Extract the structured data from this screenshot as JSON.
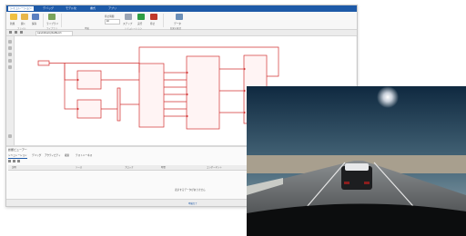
{
  "ribbon": {
    "tabs": [
      "シミュレーション",
      "デバッグ",
      "モデル化",
      "書式",
      "アプリ"
    ],
    "buttons": [
      {
        "label": "新規",
        "icon": "new-icon"
      },
      {
        "label": "開く",
        "icon": "open-folder-icon"
      },
      {
        "label": "保存",
        "icon": "save-icon"
      },
      {
        "label": "ライブラリ",
        "icon": "library-icon"
      },
      {
        "label": "ステップ",
        "icon": "step-back-icon"
      },
      {
        "label": "実行",
        "icon": "run-icon"
      },
      {
        "label": "停止",
        "icon": "stop-icon"
      },
      {
        "label": "データ",
        "icon": "data-inspector-icon"
      }
    ],
    "stop_time_label": "停止時間",
    "stop_time_value": "10",
    "groups": [
      "ファイル",
      "ライブラリ",
      "準備",
      "シミュレーション",
      "結果の確認"
    ]
  },
  "address": {
    "breadcrumb": "LaneFollowingTestBench"
  },
  "bottom": {
    "panel_title": "診断ビューアー",
    "tabs": [
      "シミュレーション",
      "デバッグ",
      "アクティビティ",
      "検索",
      "テストハーネス"
    ],
    "columns": [
      "説明",
      "ソース",
      "ブロック",
      "時間",
      "コンポーネント"
    ],
    "empty_message": "表示するデータがありません"
  },
  "status": {
    "text": "準備完了"
  },
  "colors": {
    "accent": "#1e5aa8",
    "block_stroke": "#d23232",
    "block_fill": "#fff4f4"
  }
}
